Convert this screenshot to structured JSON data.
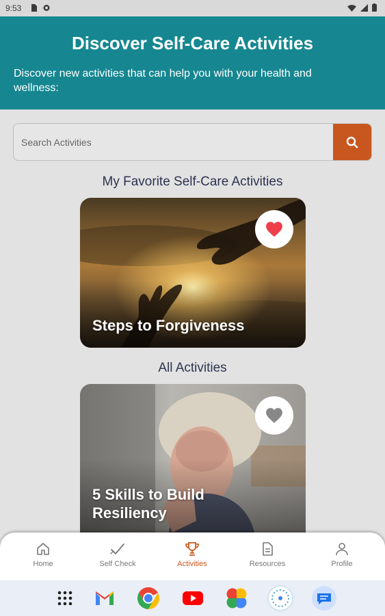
{
  "status_bar": {
    "time": "9:53"
  },
  "header": {
    "title": "Discover Self-Care Activities",
    "subtitle": "Discover new activities that can help you with your health and wellness:"
  },
  "search": {
    "placeholder": "Search Activities",
    "value": ""
  },
  "favorites": {
    "heading": "My Favorite Self-Care Activities",
    "cards": [
      {
        "title": "Steps to Forgiveness",
        "favorited": true
      }
    ]
  },
  "all_activities": {
    "heading": "All Activities",
    "cards": [
      {
        "title": "5 Skills to Build Resiliency",
        "favorited": false
      }
    ]
  },
  "bottom_nav": {
    "items": [
      {
        "label": "Home",
        "icon": "home-icon"
      },
      {
        "label": "Self Check",
        "icon": "checkmark-icon"
      },
      {
        "label": "Activities",
        "icon": "trophy-icon",
        "active": true
      },
      {
        "label": "Resources",
        "icon": "document-icon"
      },
      {
        "label": "Profile",
        "icon": "person-icon"
      }
    ]
  },
  "dock": {
    "apps": [
      "app-drawer-icon",
      "gmail-icon",
      "chrome-icon",
      "youtube-icon",
      "photos-icon",
      "assistant-icon",
      "messages-icon"
    ]
  },
  "colors": {
    "accent": "#168790",
    "action": "#c8571f",
    "favorite": "#ee3f4b"
  }
}
